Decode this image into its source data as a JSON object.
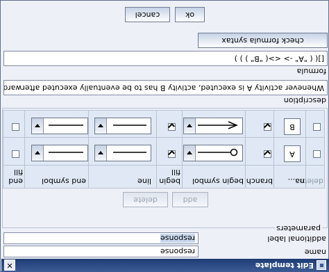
{
  "window": {
    "title": "Edit template"
  },
  "fields": {
    "name_label": "name",
    "name_value": "response",
    "additional_label_label": "additional label",
    "additional_label_value": "response"
  },
  "parameters": {
    "title": "parameters",
    "columns": {
      "delete": "delete",
      "name": "na...",
      "branch": "branch",
      "begin_symbol": "begin symbol",
      "begin_fill": "begin fill",
      "line": "line",
      "end_symbol": "end symbol",
      "end_fill": "end fill"
    },
    "rows": [
      {
        "name": "A",
        "delete": false,
        "branch": true,
        "begin_symbol": "circle",
        "begin_fill": true,
        "line": "solid",
        "end_symbol": "line",
        "end_fill": false
      },
      {
        "name": "B",
        "delete": false,
        "branch": true,
        "begin_symbol": "arrow-open",
        "begin_fill": true,
        "line": "solid",
        "end_symbol": "line",
        "end_fill": false
      }
    ],
    "add_label": "add",
    "delete_label": "delete"
  },
  "description": {
    "label": "description",
    "value": "Whenever activity A is executed, activity B has to be eventually executed afterwards."
  },
  "formula": {
    "label": "formula",
    "value": "[]( ( \"A\" -> <>( \"B\" ) ) )",
    "check_label": "check formula syntax"
  },
  "buttons": {
    "ok": "ok",
    "cancel": "cancel"
  }
}
